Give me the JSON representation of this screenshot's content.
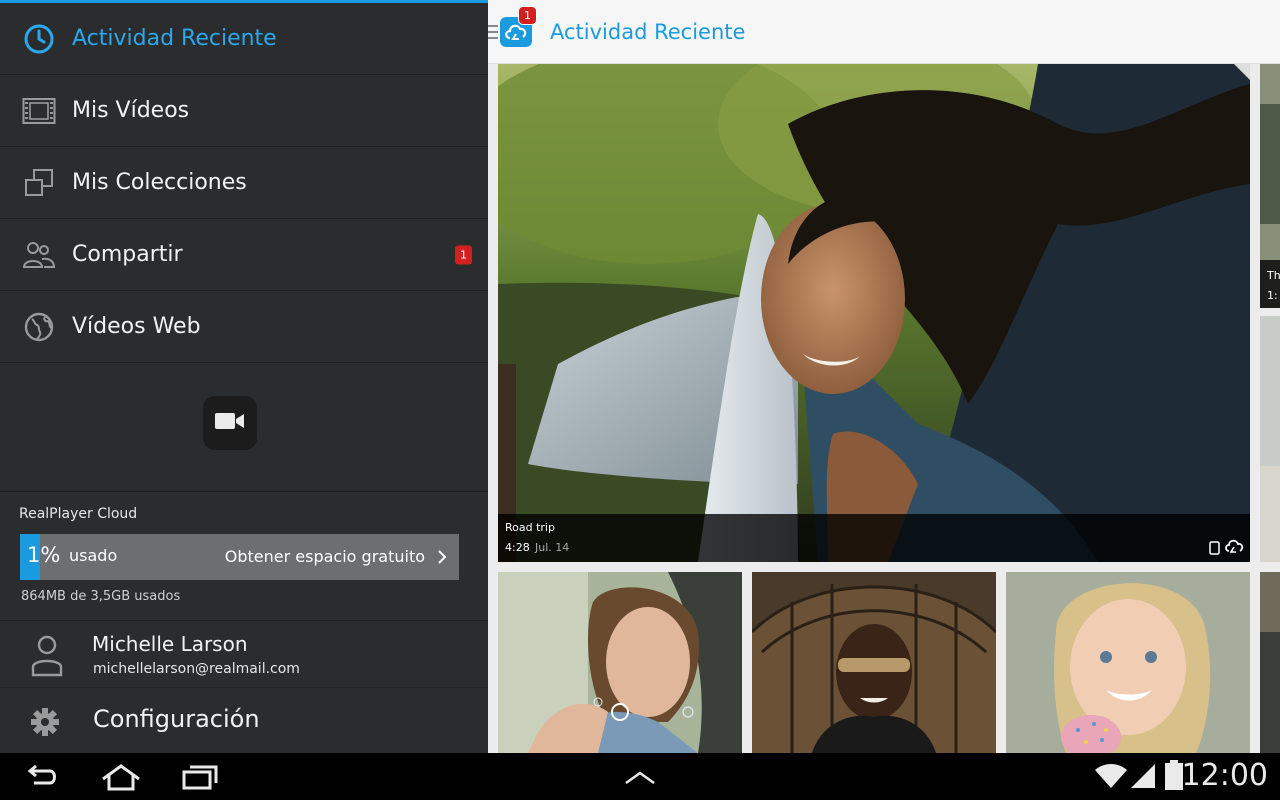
{
  "drawer": {
    "items": [
      {
        "label": "Actividad Reciente",
        "icon": "clock-icon",
        "active": true
      },
      {
        "label": "Mis Vídeos",
        "icon": "film-icon",
        "active": false
      },
      {
        "label": "Mis Colecciones",
        "icon": "collections-icon",
        "active": false
      },
      {
        "label": "Compartir",
        "icon": "people-icon",
        "active": false,
        "badge": "1"
      },
      {
        "label": "Vídeos Web",
        "icon": "globe-icon",
        "active": false
      }
    ],
    "record_icon": "video-camera-icon",
    "storage": {
      "title": "RealPlayer Cloud",
      "percent": "1%",
      "percent_value": 1,
      "used_label": "usado",
      "cta": "Obtener espacio gratuito",
      "detail": "864MB de 3,5GB usados"
    },
    "account": {
      "name": "Michelle Larson",
      "email": "michellelarson@realmail.com"
    },
    "settings": {
      "label": "Configuración",
      "icon": "gear-icon"
    }
  },
  "appbar": {
    "title": "Actividad Reciente",
    "logo_badge": "1"
  },
  "hero": {
    "title": "Road trip",
    "duration": "4:28",
    "date": "Jul. 14"
  },
  "side_top": {
    "title_fragment": "Th",
    "duration_fragment": "1:"
  },
  "thumbs": [
    {
      "subject": "woman blowing bubbles"
    },
    {
      "subject": "man with sunglasses"
    },
    {
      "subject": "girl with ice cream"
    }
  ],
  "system": {
    "clock": "12:00"
  },
  "colors": {
    "accent": "#1a9be0",
    "drawer_bg": "#2b2c2e",
    "badge": "#d41f1f"
  }
}
